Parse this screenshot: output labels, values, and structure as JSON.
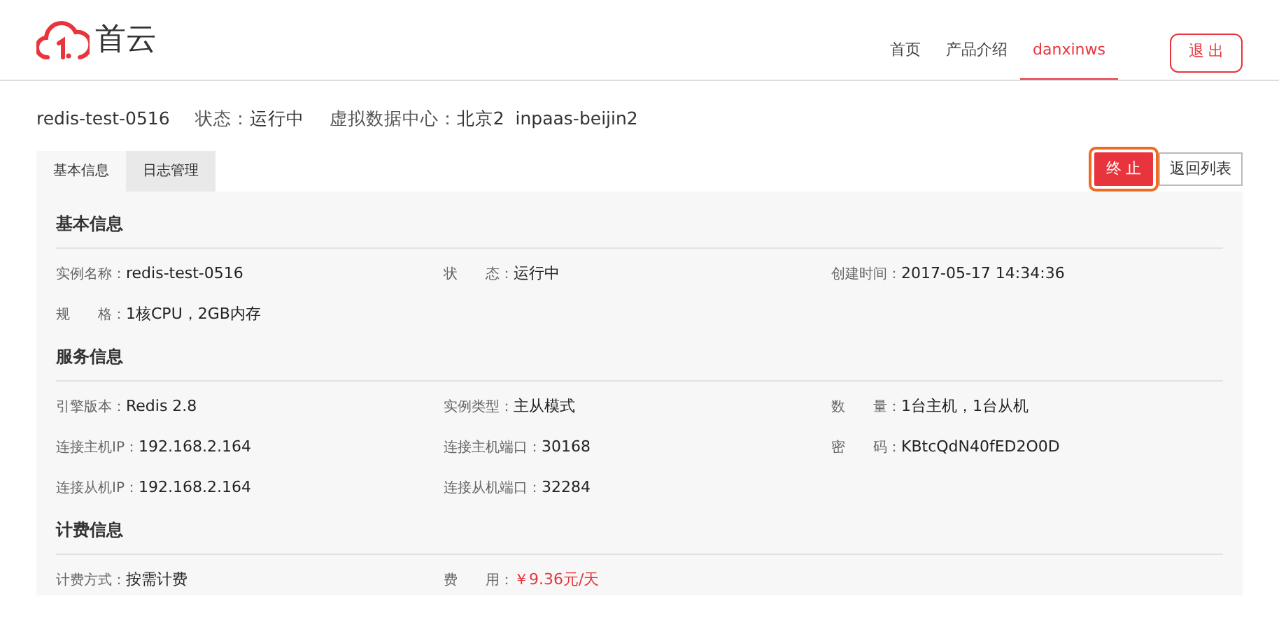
{
  "header": {
    "logo_text": "首云",
    "nav": [
      {
        "label": "首页",
        "selected": false
      },
      {
        "label": "产品介绍",
        "selected": false
      },
      {
        "label": "danxinws",
        "selected": true
      }
    ],
    "logout_button": "退 出"
  },
  "summary": {
    "instance_name": "redis-test-0516",
    "status_label": "状态：",
    "status_value": "运行中",
    "datacenter_label": "虚拟数据中心：",
    "datacenter_value": "北京2",
    "zone": "inpaas-beijin2"
  },
  "tabs": [
    {
      "label": "基本信息",
      "selected": true
    },
    {
      "label": "日志管理",
      "selected": false
    }
  ],
  "actions": [
    {
      "label": "终 止",
      "kind": "danger",
      "focused": true
    },
    {
      "label": "返回列表",
      "kind": "default",
      "focused": false
    }
  ],
  "sections": [
    {
      "title": "基本信息",
      "rows": [
        [
          {
            "label": "实例名称：",
            "value": "redis-test-0516",
            "kind": "text"
          },
          {
            "label": "状　　态：",
            "value": "运行中",
            "kind": "text"
          },
          {
            "label": "创建时间：",
            "value": "2017-05-17 14:34:36",
            "kind": "text"
          }
        ],
        [
          {
            "label": "规　　格：",
            "value": "1核CPU，2GB内存",
            "kind": "text"
          }
        ]
      ]
    },
    {
      "title": "服务信息",
      "rows": [
        [
          {
            "label": "引擎版本：",
            "value": "Redis 2.8",
            "kind": "text"
          },
          {
            "label": "实例类型：",
            "value": "主从模式",
            "kind": "text"
          },
          {
            "label": "数　　量：",
            "value": "1台主机，1台从机",
            "kind": "text"
          }
        ],
        [
          {
            "label": "连接主机IP：",
            "value": "192.168.2.164",
            "kind": "text"
          },
          {
            "label": "连接主机端口：",
            "value": "30168",
            "kind": "text"
          },
          {
            "label": "密　　码：",
            "value": "KBtcQdN40fED2O0D",
            "kind": "text"
          }
        ],
        [
          {
            "label": "连接从机IP：",
            "value": "192.168.2.164",
            "kind": "text"
          },
          {
            "label": "连接从机端口：",
            "value": "32284",
            "kind": "text"
          }
        ]
      ]
    },
    {
      "title": "计费信息",
      "rows": [
        [
          {
            "label": "计费方式：",
            "value": "按需计费",
            "kind": "text"
          },
          {
            "label": "费　　用：",
            "value": "￥9.36元/天",
            "kind": "price"
          }
        ]
      ]
    }
  ]
}
